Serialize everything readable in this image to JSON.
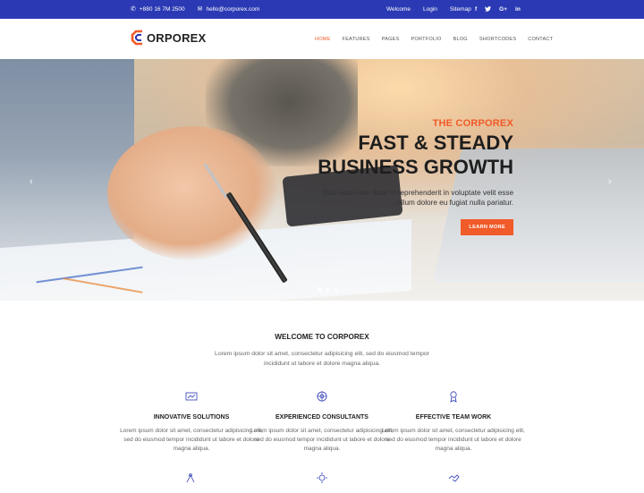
{
  "topbar": {
    "phone": "+880 16 7M 2500",
    "email": "hello@corporex.com",
    "links": [
      "Welcome",
      "Login",
      "Sitemap"
    ],
    "social": [
      "f",
      "t",
      "G+",
      "in"
    ]
  },
  "header": {
    "logo_text": "ORPOREX",
    "nav": [
      "Home",
      "Features",
      "Pages",
      "Portfolio",
      "Blog",
      "Shortcodes",
      "Contact"
    ]
  },
  "hero": {
    "kicker": "THE CORPOREX",
    "title_line1": "FAST & STEADY",
    "title_line2": "BUSINESS GROWTH",
    "subtitle_line1": "Duis aute irure dolor in reprehenderit in voluptate velit esse",
    "subtitle_line2": "cillum dolore eu fugiat nulla pariatur.",
    "button": "Learn More",
    "prev_arrow": "‹",
    "next_arrow": "›"
  },
  "welcome": {
    "heading": "WELCOME TO CORPOREX",
    "intro": "Lorem ipsum dolor sit amet, consectetur adipisicing elit, sed do eiusmod tempor incididunt ut labore et dolore magna aliqua.",
    "features": [
      {
        "icon": "chart-icon",
        "title": "INNOVATIVE SOLUTIONS",
        "desc": "Lorem ipsum dolor sit amet, consectetur adipisicing elit, sed do eiusmod tempor incididunt ut labore et dolore magna aliqua."
      },
      {
        "icon": "target-icon",
        "title": "EXPERIENCED CONSULTANTS",
        "desc": "Lorem ipsum dolor sit amet, consectetur adipisicing elit, sed do eiusmod tempor incididunt ut labore et dolore magna aliqua."
      },
      {
        "icon": "award-icon",
        "title": "EFFECTIVE TEAM WORK",
        "desc": "Lorem ipsum dolor sit amet, consectetur adipisicing elit, sed do eiusmod tempor incididunt ut labore et dolore magna aliqua."
      }
    ]
  },
  "colors": {
    "topbar": "#2b3ab4",
    "accent": "#f15a29"
  }
}
